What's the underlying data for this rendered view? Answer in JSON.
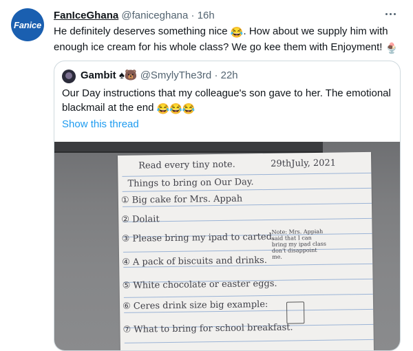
{
  "tweet": {
    "avatar_text": "Fanice",
    "display_name": "FanIceGhana",
    "handle": "@faniceghana",
    "separator": "·",
    "time": "16h",
    "text_1": "He definitely deserves something nice ",
    "emoji_1": "😂",
    "text_2": ". How about we supply him with enough ice cream for his whole class? We go kee them with Enjoyment! ",
    "emoji_2": "🍨"
  },
  "quoted": {
    "display_name": "Gambit",
    "badges": "♠🐻",
    "handle": "@SmylyThe3rd",
    "separator": "·",
    "time": "22h",
    "text": "Our Day instructions that my colleague's son gave to her. The emotional blackmail at the end ",
    "emojis": "😂😂😂",
    "show_thread": "Show this thread"
  },
  "note": {
    "heading": "Read every tiny note.",
    "date": "29thJuly, 2021",
    "subtitle": "Things to bring on Our Day.",
    "items": [
      "① Big cake for Mrs. Appah",
      "② Dolait",
      "③ Please bring my ipad to carted.",
      "④ A pack of biscuits and drinks.",
      "⑤ White chocolate or easter eggs.",
      "⑥ Ceres drink size big example:",
      "⑦ What to bring for school breakfast."
    ],
    "side_note": "Note: Mrs. Appiah said that I can bring my ipad class don't disappoint me."
  }
}
